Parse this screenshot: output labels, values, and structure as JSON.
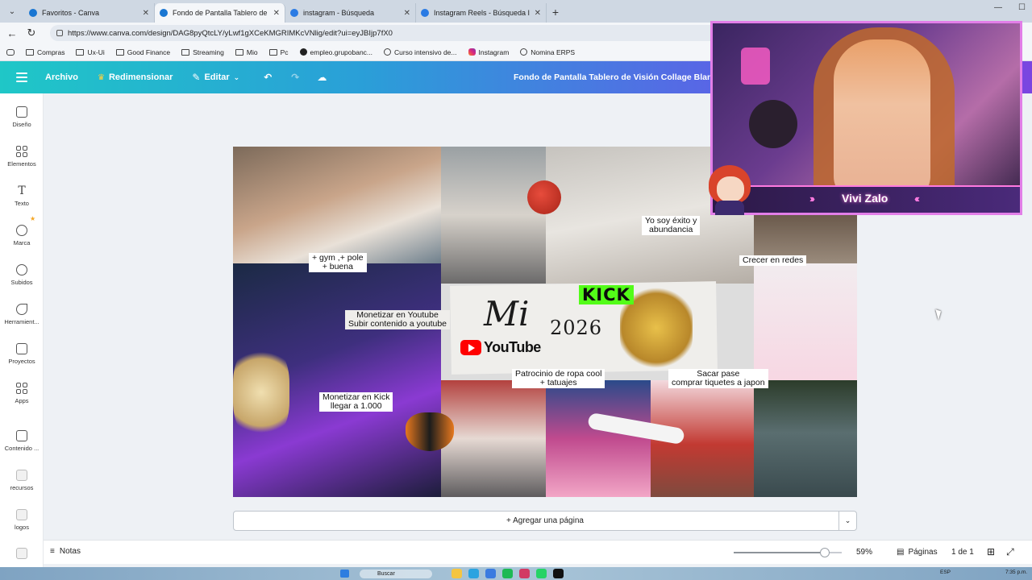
{
  "browser": {
    "tabs": [
      {
        "title": "Favoritos - Canva",
        "color": "#1976d2",
        "active": false
      },
      {
        "title": "Fondo de Pantalla Tablero de Visió",
        "color": "#1976d2",
        "active": true
      },
      {
        "title": "instagram - Búsqueda",
        "color": "#2a7be4",
        "active": false
      },
      {
        "title": "Instagram Reels - Búsqueda Imáge",
        "color": "#2a7be4",
        "active": false
      }
    ],
    "url": "https://www.canva.com/design/DAG8pyQtcLY/yLwf1gXCeKMGRIMKcVNlig/edit?ui=eyJBIjp7fX0",
    "bookmarks": [
      {
        "label": "Compras",
        "icon": "folder"
      },
      {
        "label": "Ux-Ui",
        "icon": "folder"
      },
      {
        "label": "Good Finance",
        "icon": "folder"
      },
      {
        "label": "Streaming",
        "icon": "folder"
      },
      {
        "label": "Mio",
        "icon": "folder"
      },
      {
        "label": "Pc",
        "icon": "folder"
      },
      {
        "label": "empleo.grupobanc...",
        "icon": "gp"
      },
      {
        "label": "Curso intensivo de...",
        "icon": "globe"
      },
      {
        "label": "Instagram",
        "icon": "ig"
      },
      {
        "label": "Nomina ERPS",
        "icon": "globe"
      }
    ]
  },
  "canva": {
    "menu": {
      "archivo": "Archivo",
      "redimensionar": "Redimensionar",
      "editar": "Editar"
    },
    "doc_title": "Fondo de Pantalla Tablero de Visión Collage Blanco",
    "sidebar": [
      {
        "label": "Diseño",
        "icon": "layout-icon"
      },
      {
        "label": "Elementos",
        "icon": "elements-icon"
      },
      {
        "label": "Texto",
        "icon": "text-icon"
      },
      {
        "label": "Marca",
        "icon": "brand-icon"
      },
      {
        "label": "Subidos",
        "icon": "upload-icon"
      },
      {
        "label": "Herramient...",
        "icon": "tools-icon"
      },
      {
        "label": "Proyectos",
        "icon": "folder-icon"
      },
      {
        "label": "Apps",
        "icon": "apps-icon"
      },
      {
        "label": "Contenido ...",
        "icon": "content-icon"
      },
      {
        "label": "recursos",
        "icon": "resources-icon"
      },
      {
        "label": "logos",
        "icon": "logos-icon"
      }
    ],
    "board": {
      "notes": {
        "gym": "+ gym ,+ pole\n+ buena",
        "exito": "Yo soy éxito y\nabundancia",
        "crecer": "Crecer en redes",
        "youtube": "Monetizar en Youtube\nSubir contenido a youtube",
        "kick_goal": "Monetizar en Kick\nllegar a 1.000",
        "ropa": "Patrocinio de ropa cool\n+ tatuajes",
        "pase": "Sacar pase\ncomprar tiquetes a japon"
      },
      "title_mi": "Mi",
      "title_year": "2026",
      "kick_logo": "KICK",
      "youtube_logo": "YouTube"
    },
    "add_page": "+ Agregar una página",
    "bottom": {
      "notes": "Notas",
      "zoom": "59%",
      "zoom_fraction": 0.59,
      "pages_label": "Páginas",
      "page_no": "1 de 1"
    }
  },
  "stream": {
    "name": "Vivi Zalo"
  },
  "taskbar": {
    "search": "Buscar",
    "lang": "ESP",
    "time": "7:35 p.m."
  }
}
